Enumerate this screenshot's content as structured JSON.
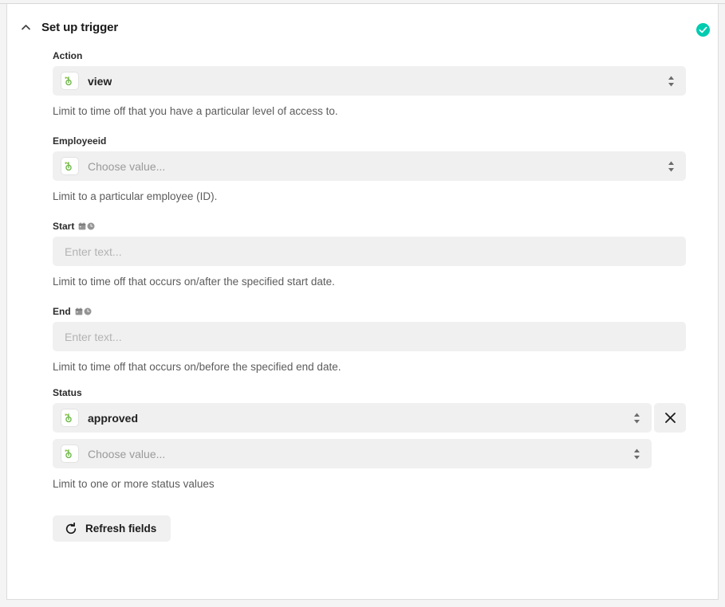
{
  "section": {
    "title": "Set up trigger",
    "collapse_icon": "chevron-up-icon",
    "status_icon": "check-circle-icon",
    "status_color": "#00ccb0",
    "expanded": true
  },
  "app": {
    "name": "BambooHR",
    "logo_icon": "bamboohr-logo-icon",
    "logo_color": "#6ab544"
  },
  "fields": [
    {
      "label": "Action",
      "type": "select",
      "value": "view",
      "is_placeholder": false,
      "help": "Limit to time off that you have a particular level of access to.",
      "label_icons": []
    },
    {
      "label": "Employeeid",
      "type": "select",
      "value": "Choose value...",
      "is_placeholder": true,
      "help": "Limit to a particular employee (ID).",
      "label_icons": []
    },
    {
      "label": "Start",
      "type": "text",
      "value": "",
      "placeholder": "Enter text...",
      "help": "Limit to time off that occurs on/after the specified start date.",
      "label_icons": [
        "calendar-icon",
        "clock-icon"
      ]
    },
    {
      "label": "End",
      "type": "text",
      "value": "",
      "placeholder": "Enter text...",
      "help": "Limit to time off that occurs on/before the specified end date.",
      "label_icons": [
        "calendar-icon",
        "clock-icon"
      ]
    }
  ],
  "status_field": {
    "label": "Status",
    "help": "Limit to one or more status values",
    "rows": [
      {
        "value": "approved",
        "is_placeholder": false,
        "removable": true,
        "remove_icon": "close-icon"
      },
      {
        "value": "Choose value...",
        "is_placeholder": true,
        "removable": false
      }
    ]
  },
  "refresh_button": {
    "label": "Refresh fields",
    "icon": "refresh-icon"
  }
}
